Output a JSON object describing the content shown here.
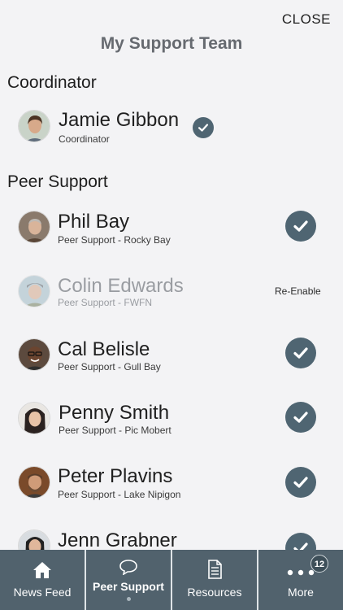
{
  "header": {
    "close_label": "CLOSE",
    "title": "My Support Team"
  },
  "sections": {
    "coordinator_title": "Coordinator",
    "peer_title": "Peer Support"
  },
  "coordinator": {
    "name": "Jamie Gibbon",
    "role": "Coordinator",
    "status": "checked"
  },
  "peers": [
    {
      "name": "Phil Bay",
      "role": "Peer Support - Rocky Bay",
      "status": "checked"
    },
    {
      "name": "Colin Edwards",
      "role": "Peer Support - FWFN",
      "status": "disabled",
      "action_label": "Re-Enable"
    },
    {
      "name": "Cal Belisle",
      "role": "Peer Support - Gull Bay",
      "status": "checked"
    },
    {
      "name": "Penny Smith",
      "role": "Peer Support - Pic Mobert",
      "status": "checked"
    },
    {
      "name": "Peter Plavins",
      "role": "Peer Support - Lake Nipigon",
      "status": "checked"
    },
    {
      "name": "Jenn Grabner",
      "role": "",
      "status": "checked"
    }
  ],
  "tabbar": {
    "tabs": [
      {
        "label": "News Feed",
        "icon": "home-icon"
      },
      {
        "label": "Peer Support",
        "icon": "chat-bubble-icon",
        "active": true
      },
      {
        "label": "Resources",
        "icon": "document-icon"
      },
      {
        "label": "More",
        "icon": "more-dots-icon",
        "badge": "12"
      }
    ]
  },
  "colors": {
    "accent": "#4f6572",
    "tabbar_bg": "#51626d",
    "background": "#f3f3f5"
  }
}
